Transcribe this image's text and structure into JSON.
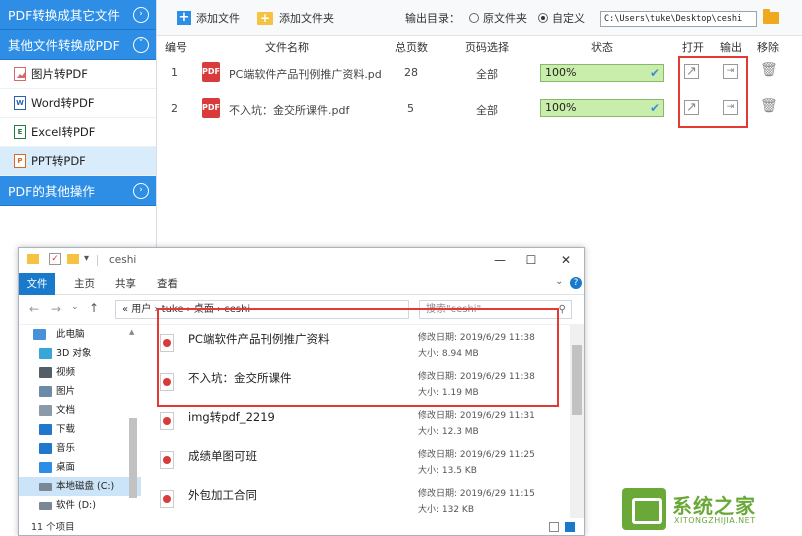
{
  "sidebar": {
    "sections": [
      {
        "label": "PDF转换成其它文件",
        "chevron": "›"
      },
      {
        "label": "其他文件转换成PDF",
        "chevron": "˅"
      }
    ],
    "items": [
      {
        "label": "图片转PDF",
        "icon": "image-file-icon"
      },
      {
        "label": "Word转PDF",
        "icon": "word-file-icon",
        "badge": "W"
      },
      {
        "label": "Excel转PDF",
        "icon": "excel-file-icon",
        "badge": "E"
      },
      {
        "label": "PPT转PDF",
        "icon": "ppt-file-icon",
        "badge": "P",
        "active": true
      }
    ],
    "footer_section": {
      "label": "PDF的其他操作",
      "chevron": "›"
    }
  },
  "toolbar": {
    "add_file": "添加文件",
    "add_folder": "添加文件夹",
    "output_label": "输出目录：",
    "option_original": "原文件夹",
    "option_custom": "自定义",
    "output_path": "C:\\Users\\tuke\\Desktop\\ceshi"
  },
  "table": {
    "headers": [
      "编号",
      "文件名称",
      "总页数",
      "页码选择",
      "状态",
      "打开",
      "输出",
      "移除"
    ],
    "rows": [
      {
        "index": "1",
        "name": "PC端软件产品刊例推广资料.pd",
        "pages": "28",
        "range": "全部",
        "status": "100%"
      },
      {
        "index": "2",
        "name": "不入坑：金交所课件.pdf",
        "pages": "5",
        "range": "全部",
        "status": "100%"
      }
    ]
  },
  "explorer": {
    "title": "ceshi",
    "win_controls": {
      "minimize": "—",
      "maximize": "☐",
      "close": "✕"
    },
    "ribbon_tabs": [
      "文件",
      "主页",
      "共享",
      "查看"
    ],
    "help": "?",
    "breadcrumb": "« 用户 › tuke › 桌面 › ceshi",
    "search_placeholder": "搜索\"ceshi\"",
    "nav": [
      {
        "label": "此电脑",
        "color": "#4a90d9"
      },
      {
        "label": "3D 对象",
        "color": "#38a6d6"
      },
      {
        "label": "视频",
        "color": "#555d66"
      },
      {
        "label": "图片",
        "color": "#6a8ca8"
      },
      {
        "label": "文档",
        "color": "#8a9aab"
      },
      {
        "label": "下载",
        "color": "#1f78cc"
      },
      {
        "label": "音乐",
        "color": "#1f78cc"
      },
      {
        "label": "桌面",
        "color": "#2e8ee6"
      },
      {
        "label": "本地磁盘 (C:)",
        "color": "#7a8794",
        "selected": true
      },
      {
        "label": "软件 (D:)",
        "color": "#7a8794"
      }
    ],
    "files": [
      {
        "name": "PC端软件产品刊例推广资料",
        "date": "修改日期: 2019/6/29 11:38",
        "size": "大小: 8.94 MB"
      },
      {
        "name": "不入坑：金交所课件",
        "date": "修改日期: 2019/6/29 11:38",
        "size": "大小: 1.19 MB"
      },
      {
        "name": "img转pdf_2219",
        "date": "修改日期: 2019/6/29 11:31",
        "size": "大小: 12.3 MB"
      },
      {
        "name": "成绩单图可班",
        "date": "修改日期: 2019/6/29 11:25",
        "size": "大小: 13.5 KB"
      },
      {
        "name": "外包加工合同",
        "date": "修改日期: 2019/6/29 11:15",
        "size": "大小: 132 KB"
      }
    ],
    "status": "11 个项目"
  },
  "watermark": {
    "text": "系统之家",
    "sub": "XITONGZHIJIA.NET"
  },
  "colors": {
    "accent": "#2e8ee6",
    "status_fill": "#c9edaa",
    "highlight": "#e53935"
  }
}
